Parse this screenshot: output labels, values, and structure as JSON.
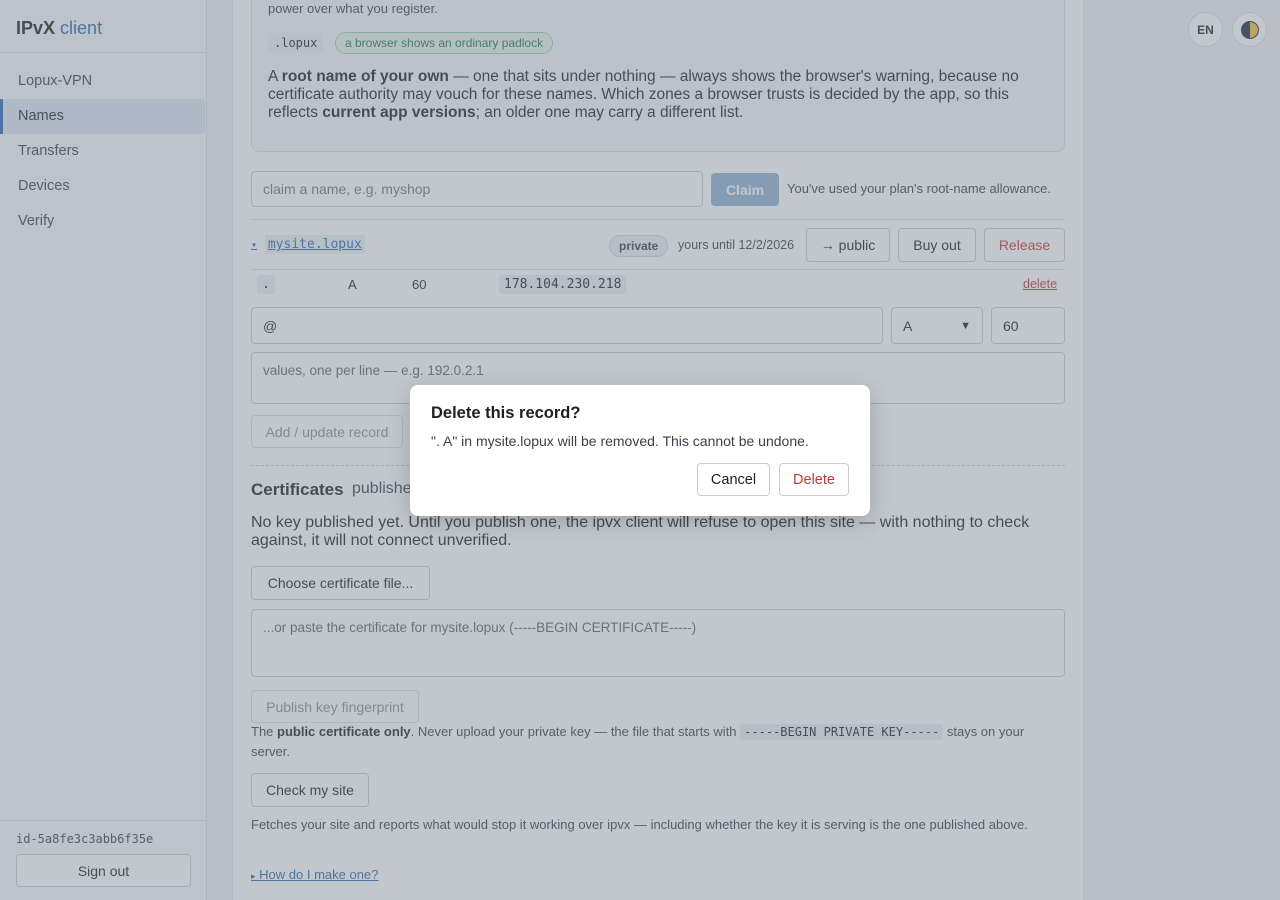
{
  "sidebar": {
    "brand_main": "IPvX",
    "brand_accent": "client",
    "items": [
      {
        "label": "Lopux-VPN"
      },
      {
        "label": "Names"
      },
      {
        "label": "Transfers"
      },
      {
        "label": "Devices"
      },
      {
        "label": "Verify"
      }
    ],
    "active_index": 1,
    "device_id": "id-5a8fe3c3abb6f35e",
    "sign_out": "Sign out"
  },
  "topbar": {
    "lang": "EN",
    "theme_icon": "half-moon-icon"
  },
  "info_box": {
    "line1": "power over what you register.",
    "zone": ".lopux",
    "zone_badge": "a browser shows an ordinary padlock",
    "para_a": "A ",
    "para_b": "root name of your own",
    "para_c": " — one that sits under nothing — always shows the browser's warning, because no certificate authority may vouch for these names. Which zones a browser trusts is decided by the app, so this reflects ",
    "para_d": "current app versions",
    "para_e": "; an older one may carry a different list."
  },
  "claim": {
    "placeholder": "claim a name, e.g. myshop",
    "button": "Claim",
    "note": "You've used your plan's root-name allowance."
  },
  "name_row": {
    "caret": "▾",
    "name": "mysite.lopux",
    "visibility": "private",
    "until": "yours until 12/2/2026",
    "to_public": "→ public",
    "buy_out": "Buy out",
    "release": "Release"
  },
  "record": {
    "host": ".",
    "type": "A",
    "ttl": "60",
    "value": "178.104.230.218",
    "delete": "delete"
  },
  "record_form": {
    "host_value": "@",
    "type_value": "A",
    "ttl_value": "60",
    "values_placeholder": "values, one per line — e.g. 192.0.2.1",
    "submit": "Add / update record"
  },
  "certificates": {
    "heading": "Certificates",
    "subheading": "publishe",
    "no_key": "No key published yet. Until you publish one, the ipvx client will refuse to open this site — with nothing to check against, it will not connect unverified.",
    "choose_file": "Choose certificate file...",
    "paste_placeholder": "...or paste the certificate for mysite.lopux (-----BEGIN CERTIFICATE-----)",
    "publish": "Publish key fingerprint",
    "note_a": "The ",
    "note_b": "public certificate only",
    "note_c": ". Never upload your private key — the file that starts with ",
    "note_code": "-----BEGIN PRIVATE KEY-----",
    "note_d": " stays on your server.",
    "check": "Check my site",
    "fetch_note": "Fetches your site and reports what would stop it working over ipvx — including whether the key it is serving is the one published above.",
    "howto": "How do I make one?",
    "howto_caret": "▸"
  },
  "modal": {
    "title": "Delete this record?",
    "body": "\". A\" in mysite.lopux will be removed. This cannot be undone.",
    "cancel": "Cancel",
    "confirm": "Delete"
  },
  "colors": {
    "accent": "#2a6bb0",
    "danger": "#c43838",
    "success": "#237a3b"
  }
}
